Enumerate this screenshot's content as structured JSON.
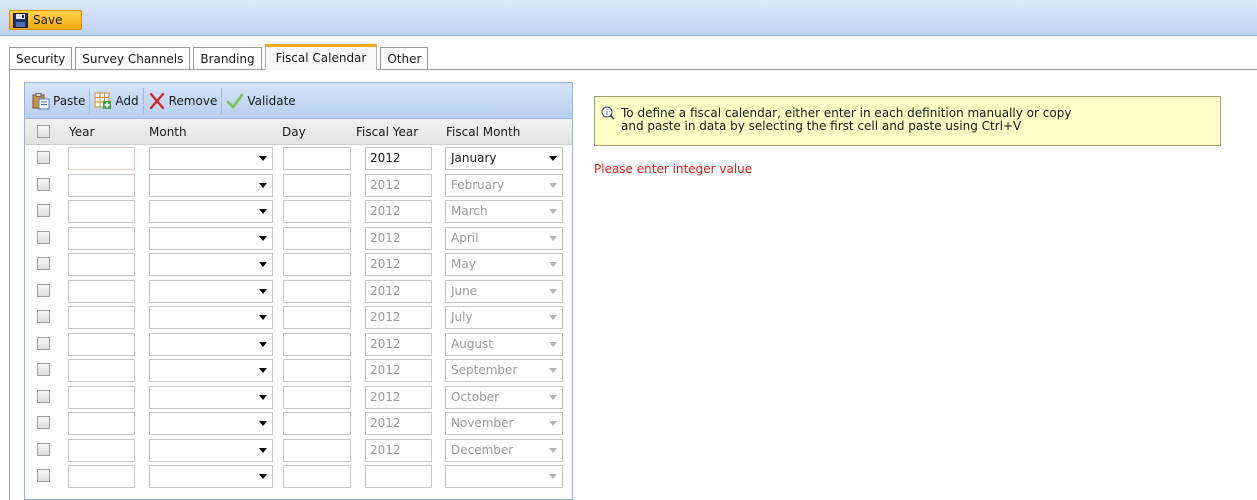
{
  "toolbar": {
    "save_label": "Save"
  },
  "tabs": [
    {
      "label": "Security",
      "active": false
    },
    {
      "label": "Survey Channels",
      "active": false
    },
    {
      "label": "Branding",
      "active": false
    },
    {
      "label": "Fiscal Calendar",
      "active": true
    },
    {
      "label": "Other",
      "active": false
    }
  ],
  "grid": {
    "toolbar": {
      "paste": "Paste",
      "add": "Add",
      "remove": "Remove",
      "validate": "Validate"
    },
    "columns": {
      "year": "Year",
      "month": "Month",
      "day": "Day",
      "fiscal_year": "Fiscal Year",
      "fiscal_month": "Fiscal Month"
    },
    "rows": [
      {
        "fiscal_year": "2012",
        "fiscal_month": "January",
        "enabled": true
      },
      {
        "fiscal_year": "2012",
        "fiscal_month": "February",
        "enabled": false
      },
      {
        "fiscal_year": "2012",
        "fiscal_month": "March",
        "enabled": false
      },
      {
        "fiscal_year": "2012",
        "fiscal_month": "April",
        "enabled": false
      },
      {
        "fiscal_year": "2012",
        "fiscal_month": "May",
        "enabled": false
      },
      {
        "fiscal_year": "2012",
        "fiscal_month": "June",
        "enabled": false
      },
      {
        "fiscal_year": "2012",
        "fiscal_month": "July",
        "enabled": false
      },
      {
        "fiscal_year": "2012",
        "fiscal_month": "August",
        "enabled": false
      },
      {
        "fiscal_year": "2012",
        "fiscal_month": "September",
        "enabled": false
      },
      {
        "fiscal_year": "2012",
        "fiscal_month": "October",
        "enabled": false
      },
      {
        "fiscal_year": "2012",
        "fiscal_month": "November",
        "enabled": false
      },
      {
        "fiscal_year": "2012",
        "fiscal_month": "December",
        "enabled": false
      },
      {
        "fiscal_year": "",
        "fiscal_month": "",
        "enabled": false
      }
    ]
  },
  "info": {
    "text_line1": "To define a fiscal calendar, either enter in each definition manually or copy",
    "text_line2": "and paste in data by selecting the first cell and paste using Ctrl+V"
  },
  "error": {
    "message": "Please enter integer value"
  },
  "colors": {
    "accent_tab": "#f4a81c",
    "error_text": "#e0201a",
    "info_bg": "#ffffc6",
    "toolbar_bg": "#bcd3f3"
  }
}
